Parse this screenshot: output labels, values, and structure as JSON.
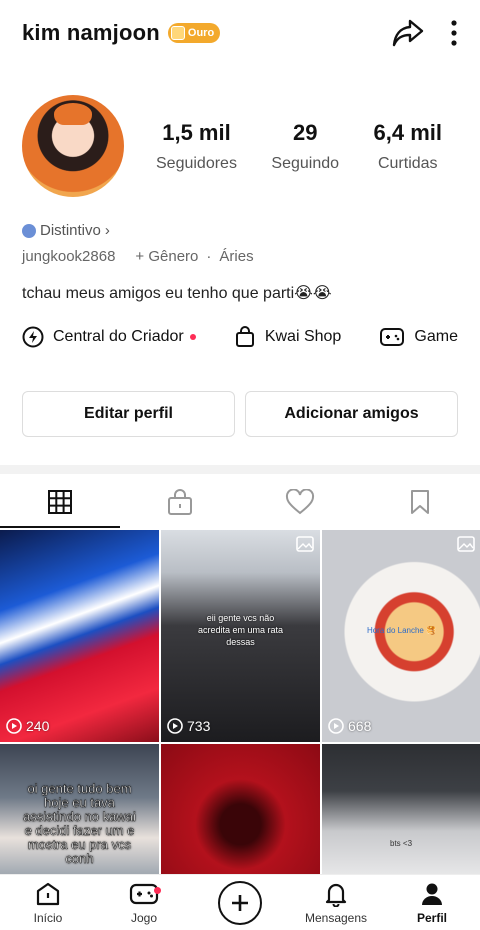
{
  "header": {
    "username": "kim namjoon",
    "badge_label": "Ouro",
    "badge_color": "#f3a92c",
    "share_icon": "share-arrow-icon",
    "more_icon": "more-vertical-icon"
  },
  "profile": {
    "avatar_icon": "avatar",
    "stats": [
      {
        "value": "1,5 mil",
        "label": "Seguidores"
      },
      {
        "value": "29",
        "label": "Seguindo"
      },
      {
        "value": "6,4 mil",
        "label": "Curtidas"
      }
    ],
    "distintivo": "Distintivo",
    "handle": "jungkook2868",
    "gender": "+ Gênero",
    "sign": "Áries",
    "bio": "tchau meus amigos eu tenho que parti😭😭"
  },
  "shortcuts": [
    {
      "label": "Central do Criador",
      "icon": "lightning-icon",
      "dot": true
    },
    {
      "label": "Kwai Shop",
      "icon": "shopping-bag-icon"
    },
    {
      "label": "Game",
      "icon": "gamepad-icon"
    }
  ],
  "buttons": {
    "edit": "Editar perfil",
    "add_friends": "Adicionar amigos"
  },
  "tabs": [
    {
      "icon": "grid-icon",
      "active": true
    },
    {
      "icon": "lock-icon"
    },
    {
      "icon": "heart-icon"
    },
    {
      "icon": "bookmark-icon"
    }
  ],
  "grid": [
    {
      "count": "240"
    },
    {
      "count": "733",
      "text": "eii gente vcs não acredita em uma rata dessas"
    },
    {
      "count": "668",
      "caption": "Hora do Lanche 🥞"
    },
    {
      "text": "oi gente tudo bem hoje eu tava assistindo no kawai e decidi fazer um e mostra eu pra vcs conh"
    },
    {},
    {
      "text": "bts <3"
    }
  ],
  "bottom_nav": [
    {
      "label": "Início",
      "icon": "home-icon"
    },
    {
      "label": "Jogo",
      "icon": "gamepad-icon",
      "dot": true
    },
    {
      "label": "",
      "icon": "create-plus-icon"
    },
    {
      "label": "Mensagens",
      "icon": "bell-icon"
    },
    {
      "label": "Perfil",
      "icon": "person-icon",
      "active": true
    }
  ],
  "colors": {
    "accent_red": "#fe2c55",
    "divider": "#f2f2f2"
  }
}
